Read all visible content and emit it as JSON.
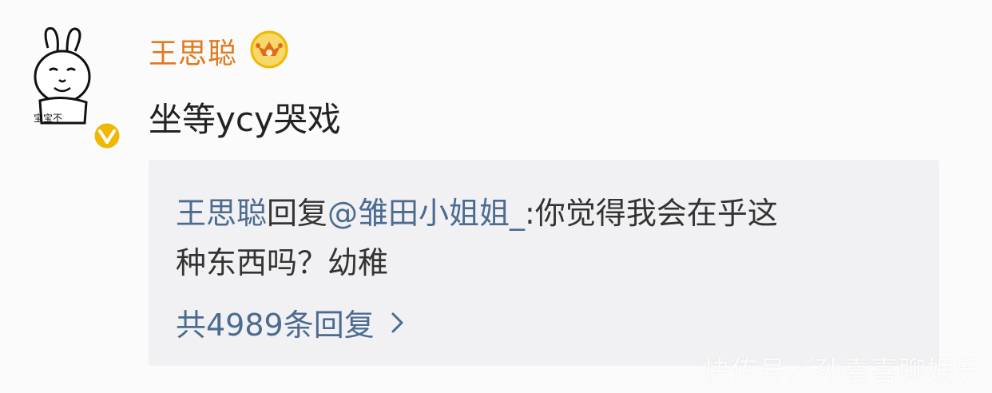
{
  "comment": {
    "username": "王思聪",
    "text": "坐等ycy哭戏"
  },
  "reply": {
    "user": "王思聪",
    "reply_word": "回复",
    "mention": "@雏田小姐姐_",
    "text_line1": ":你觉得我会在乎这",
    "text_line2": "种东西吗？幼稚",
    "count_label": "共4989条回复"
  },
  "watermark": "快传号／孙喜喜聊娱乐",
  "avatar_caption": "宝宝不",
  "colors": {
    "username": "#e07a1e",
    "link": "#4b6b91",
    "text": "#222222",
    "reply_bg": "#f1f1f3",
    "verified": "#f2b705"
  },
  "icons": {
    "avatar": "rabbit-meme-avatar",
    "verified": "verified-badge-icon",
    "crown": "crown-vip-icon",
    "chevron": "chevron-right-icon"
  }
}
